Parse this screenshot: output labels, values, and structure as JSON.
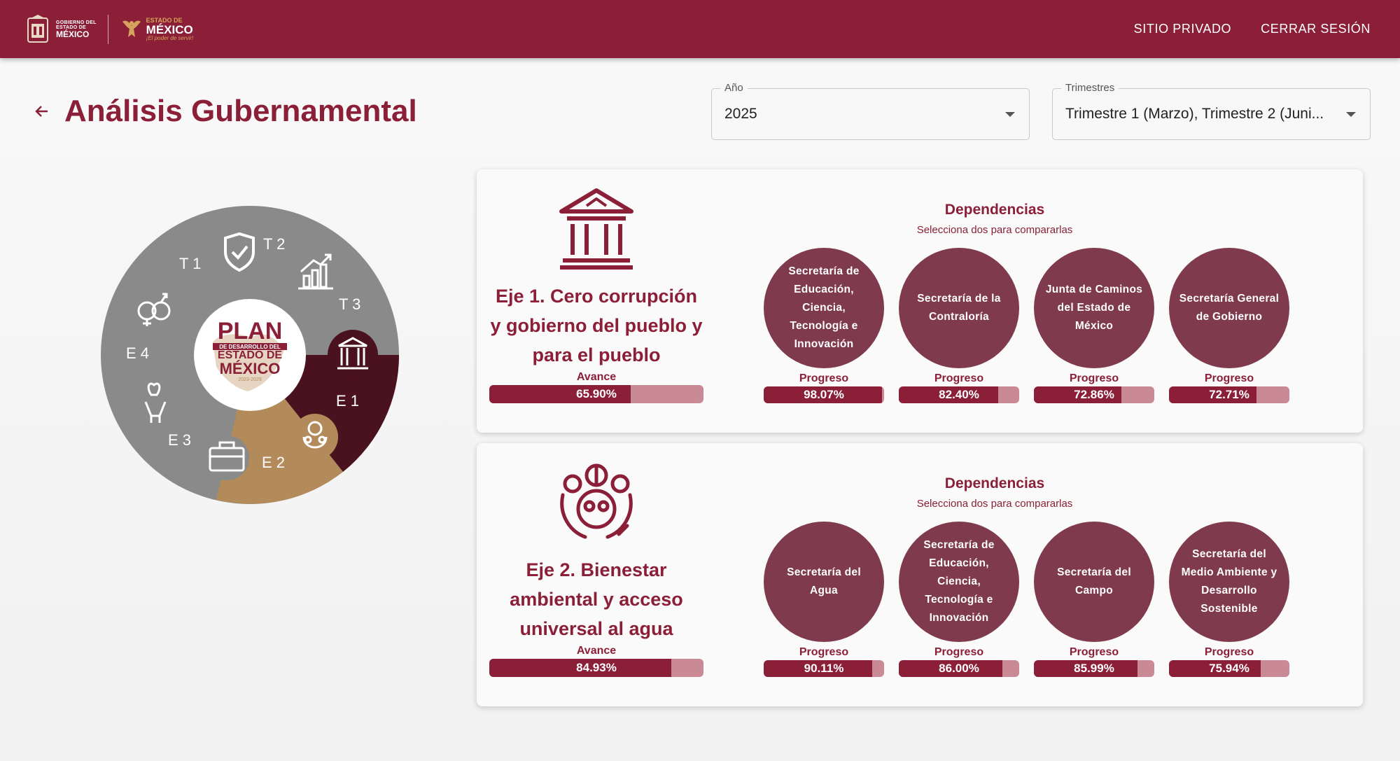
{
  "header": {
    "logo_gob": {
      "small1": "GOBIERNO DEL",
      "small2": "ESTADO DE",
      "big": "MÉXICO"
    },
    "logo_edomex": {
      "top": "ESTADO DE",
      "main": "MÉXICO",
      "tagline": "¡El poder de servir!"
    },
    "nav": {
      "private": "SITIO PRIVADO",
      "logout": "CERRAR SESIÓN"
    }
  },
  "page": {
    "title": "Análisis Gubernamental"
  },
  "filters": {
    "anio": {
      "label": "Año",
      "value": "2025"
    },
    "trimestres": {
      "label": "Trimestres",
      "value": "Trimestre 1 (Marzo), Trimestre 2 (Juni..."
    }
  },
  "wheel": {
    "labels": {
      "t1": "T 1",
      "t2": "T 2",
      "t3": "T 3",
      "e1": "E 1",
      "e2": "E 2",
      "e3": "E 3",
      "e4": "E 4"
    },
    "center": {
      "plan": "PLAN",
      "line2": "DE DESARROLLO DEL",
      "line3": "ESTADO DE",
      "line4": "MÉXICO",
      "years": "2023-2029"
    },
    "colors": {
      "gray": "#8a8a8a",
      "e1": "#4a111e",
      "e2": "#b38a5a",
      "center": "#ffffff"
    }
  },
  "ejes": [
    {
      "title": "Eje 1. Cero corrupción y gobierno del pueblo y para el pueblo",
      "icon": "government-building-icon",
      "avance_label": "Avance",
      "avance": 65.9,
      "avance_text": "65.90%",
      "dep_title": "Dependencias",
      "dep_sub": "Selecciona dos para compararlas",
      "dependencias": [
        {
          "name": "Secretaría de Educación, Ciencia, Tecnología e Innovación",
          "label": "Progreso",
          "value": 98.07,
          "text": "98.07%"
        },
        {
          "name": "Secretaría de la Contraloría",
          "label": "Progreso",
          "value": 82.4,
          "text": "82.40%"
        },
        {
          "name": "Junta de Caminos del Estado de México",
          "label": "Progreso",
          "value": 72.86,
          "text": "72.86%"
        },
        {
          "name": "Secretaría General de Gobierno",
          "label": "Progreso",
          "value": 72.71,
          "text": "72.71%"
        }
      ]
    },
    {
      "title": "Eje 2. Bienestar ambiental y acceso universal al agua",
      "icon": "environment-hands-icon",
      "avance_label": "Avance",
      "avance": 84.93,
      "avance_text": "84.93%",
      "dep_title": "Dependencias",
      "dep_sub": "Selecciona dos para compararlas",
      "dependencias": [
        {
          "name": "Secretaría del Agua",
          "label": "Progreso",
          "value": 90.11,
          "text": "90.11%"
        },
        {
          "name": "Secretaría de Educación, Ciencia, Tecnología e Innovación",
          "label": "Progreso",
          "value": 86.0,
          "text": "86.00%"
        },
        {
          "name": "Secretaría del Campo",
          "label": "Progreso",
          "value": 85.99,
          "text": "85.99%"
        },
        {
          "name": "Secretaría del Medio Ambiente y Desarrollo Sostenible",
          "label": "Progreso",
          "value": 75.94,
          "text": "75.94%"
        }
      ]
    }
  ],
  "colors": {
    "brand": "#8b1f37",
    "circle": "#7f3a4e",
    "bar_bg": "#c98a96"
  }
}
